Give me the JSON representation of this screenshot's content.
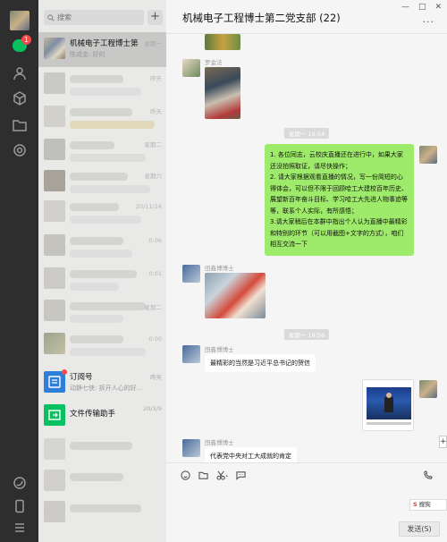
{
  "nav": {
    "chat_badge": "1",
    "icons": [
      "chat-icon",
      "contacts-icon",
      "cube-icon",
      "folder-icon",
      "moments-icon",
      "mini-program-icon",
      "phone-icon",
      "menu-icon"
    ]
  },
  "search": {
    "placeholder": "搜索",
    "add_label": "+"
  },
  "chat_list": {
    "active": {
      "name": "机械电子工程博士第...",
      "time": "星期一",
      "preview": "陈成金: 好的"
    },
    "blurred_times": [
      "昨天",
      "昨天",
      "星期二",
      "星期六",
      "20/11/24",
      "0:06",
      "0:01",
      "星期二",
      "0:00"
    ],
    "subscription": {
      "name": "订阅号",
      "time": "昨天",
      "preview": "动静七侠: 拆开人心的好..."
    },
    "file_helper": {
      "name": "文件传输助手",
      "time": "20/3/9"
    }
  },
  "chat": {
    "title": "机械电子工程博士第二党支部 (22)",
    "window_controls": [
      "—",
      "□",
      "✕"
    ],
    "more": "···",
    "messages": {
      "sender1": "罗金法",
      "time1": "星期一 19:54",
      "green_text": "1. 各位同志，云校庆直播还在进行中，如果大家还没拍照取证，请尽快操作；\n2. 请大家根据观看直播的情况，写一份简短的心得体会，可以但不限于回顾哈工大建校百年历史、展望新百年奋斗目标、学习哈工大先进人物事迹等等，联系个人实际，有所感悟；\n3.请大家稍后在本群中指出个人认为直播中最精彩和特别的环节（可以用截图+文字的方式），咱们相互交流一下",
      "sender2": "田鑫博博士",
      "time2": "星期一 19:56",
      "sender3": "田鑫博博士",
      "reply1": "最精彩的当然是习近平总书记的贺信",
      "sender4": "田鑫博博士",
      "reply2": "代表党中央对工大成就的肯定"
    }
  },
  "input": {
    "send_label": "发送(S)",
    "sogou_label": "搜狗"
  }
}
